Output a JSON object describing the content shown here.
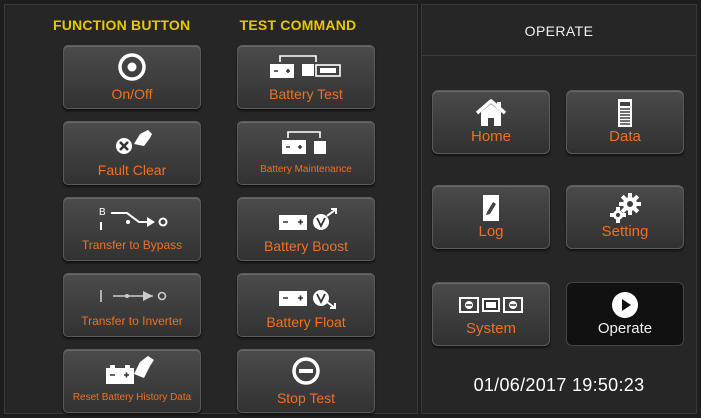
{
  "function_column": {
    "header": "FUNCTION BUTTON",
    "buttons": [
      {
        "label": "On/Off",
        "icon": "power-ring-icon"
      },
      {
        "label": "Fault Clear",
        "icon": "fault-clear-icon"
      },
      {
        "label": "Transfer to Bypass",
        "icon": "bypass-switch-icon"
      },
      {
        "label": "Transfer to Inverter",
        "icon": "inverter-switch-icon"
      },
      {
        "label": "Reset Battery History Data",
        "icon": "battery-broom-icon"
      }
    ]
  },
  "test_column": {
    "header": "TEST COMMAND",
    "buttons": [
      {
        "label": "Battery Test",
        "icon": "battery-test-icon"
      },
      {
        "label": "Battery Maintenance",
        "icon": "battery-maintenance-icon"
      },
      {
        "label": "Battery Boost",
        "icon": "battery-boost-icon"
      },
      {
        "label": "Battery Float",
        "icon": "battery-float-icon"
      },
      {
        "label": "Stop Test",
        "icon": "stop-icon"
      }
    ]
  },
  "operate_panel": {
    "header": "OPERATE",
    "nav": [
      {
        "label": "Home",
        "icon": "home-icon"
      },
      {
        "label": "Data",
        "icon": "data-icon"
      },
      {
        "label": "Log",
        "icon": "log-icon"
      },
      {
        "label": "Setting",
        "icon": "gears-icon"
      },
      {
        "label": "System",
        "icon": "system-icon"
      },
      {
        "label": "Operate",
        "icon": "play-icon",
        "active": true
      }
    ],
    "datetime": "01/06/2017 19:50:23"
  },
  "colors": {
    "header_yellow": "#e8c800",
    "label_orange": "#f07020",
    "background": "#1e1e1e"
  }
}
